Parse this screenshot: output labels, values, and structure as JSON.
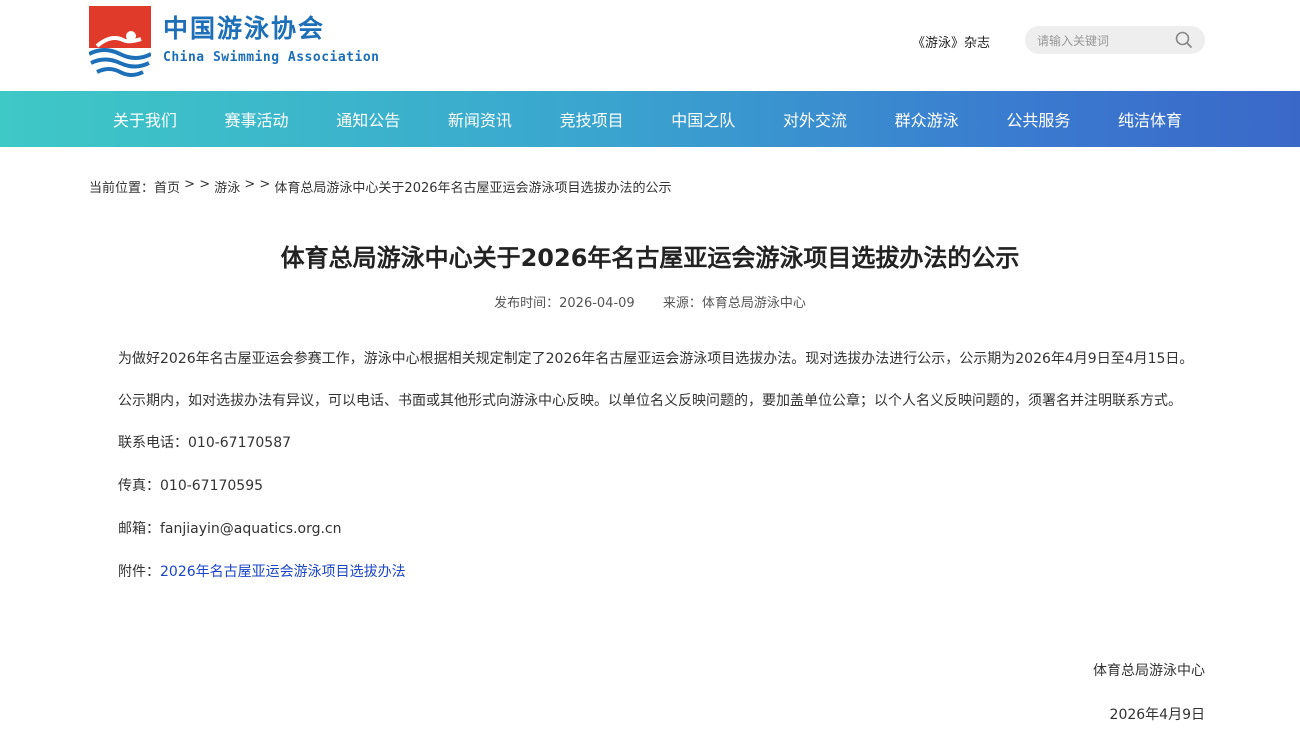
{
  "header": {
    "logo_cn": "中国游泳协会",
    "logo_en": "China Swimming Association",
    "magazine_link": "《游泳》杂志",
    "search_placeholder": "请输入关键词"
  },
  "nav": {
    "items": [
      "关于我们",
      "赛事活动",
      "通知公告",
      "新闻资讯",
      "竞技项目",
      "中国之队",
      "对外交流",
      "群众游泳",
      "公共服务",
      "纯洁体育"
    ]
  },
  "breadcrumb": {
    "prefix": "当前位置：",
    "home": "首页",
    "sep": " > > ",
    "section": "游泳",
    "current": "体育总局游泳中心关于2026年名古屋亚运会游泳项目选拔办法的公示"
  },
  "article": {
    "title": "体育总局游泳中心关于2026年名古屋亚运会游泳项目选拔办法的公示",
    "publish_label": "发布时间：2026-04-09",
    "source_label": "来源：体育总局游泳中心",
    "para1": "为做好2026年名古屋亚运会参赛工作，游泳中心根据相关规定制定了2026年名古屋亚运会游泳项目选拔办法。现对选拔办法进行公示，公示期为2026年4月9日至4月15日。",
    "para2": "公示期内，如对选拔办法有异议，可以电话、书面或其他形式向游泳中心反映。以单位名义反映问题的，要加盖单位公章；以个人名义反映问题的，须署名并注明联系方式。",
    "phone": "联系电话：010-67170587",
    "fax": "传真：010-67170595",
    "email": "邮箱：fanjiayin@aquatics.org.cn",
    "attachment_label": "附件：",
    "attachment_link": "2026年名古屋亚运会游泳项目选拔办法",
    "signature": "体育总局游泳中心",
    "date": "2026年4月9日"
  },
  "colors": {
    "nav_start": "#3ec8c6",
    "nav_end": "#3a68c9",
    "logo_blue": "#1d6fb8",
    "logo_red": "#e03a2b",
    "link": "#1b45c8"
  }
}
